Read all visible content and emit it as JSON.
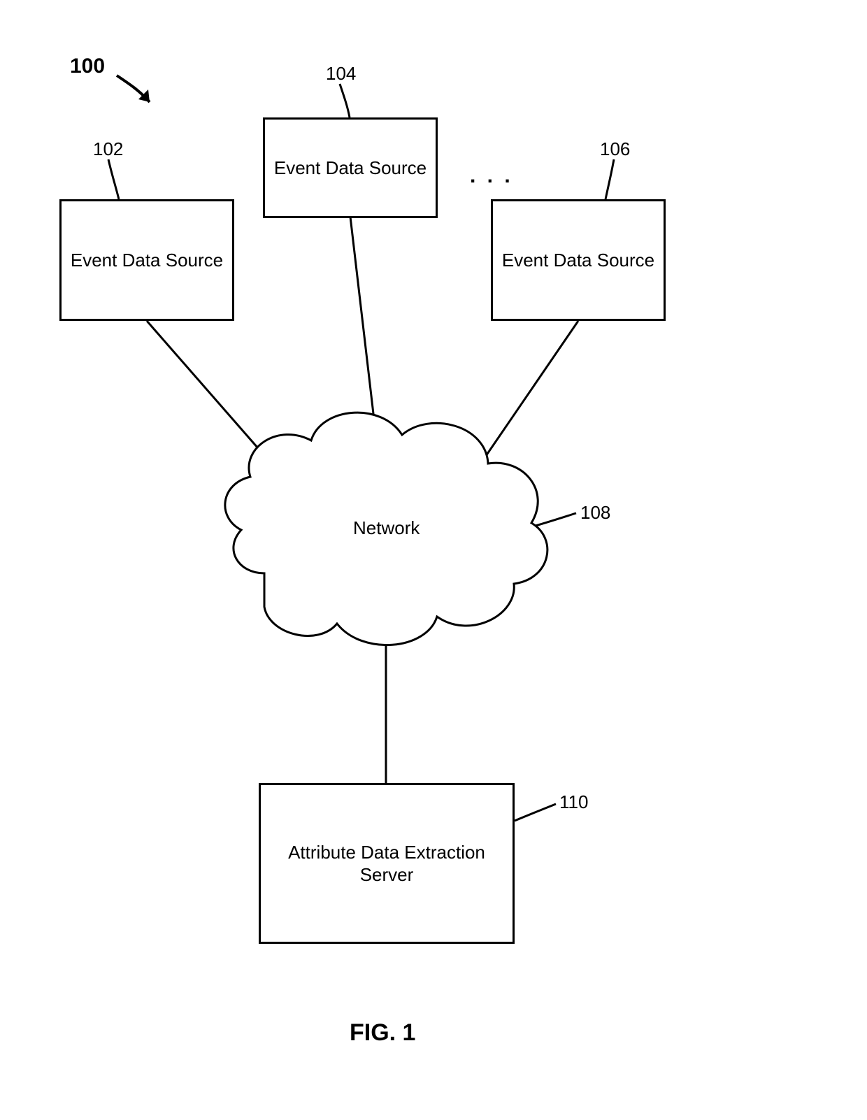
{
  "figure": {
    "system_ref": "100",
    "caption": "FIG. 1"
  },
  "nodes": {
    "source_102": {
      "ref": "102",
      "label": "Event Data Source"
    },
    "source_104": {
      "ref": "104",
      "label": "Event Data Source"
    },
    "source_106": {
      "ref": "106",
      "label": "Event Data Source"
    },
    "network": {
      "ref": "108",
      "label": "Network"
    },
    "server": {
      "ref": "110",
      "label": "Attribute Data Extraction Server"
    }
  },
  "ellipsis": ". . ."
}
